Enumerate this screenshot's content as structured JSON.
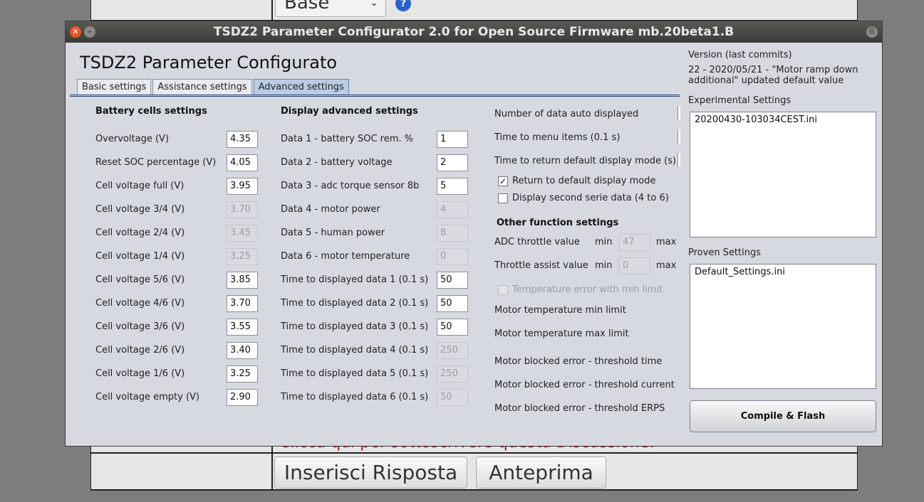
{
  "background": {
    "select_value": "Base",
    "help_icon": "help-icon",
    "subscribe_text": "Clicca qui per sottoscrivere questa Discussione.",
    "reply_button": "Inserisci Risposta",
    "preview_button": "Anteprima"
  },
  "window": {
    "title": "TSDZ2 Parameter Configurator 2.0 for Open Source Firmware mb.20beta1.B",
    "app_title": "TSDZ2 Parameter Configurato",
    "tabs": [
      "Basic settings",
      "Assistance settings",
      "Advanced settings"
    ],
    "active_tab": "Advanced settings"
  },
  "battery": {
    "title": "Battery cells settings",
    "rows": [
      {
        "label": "Overvoltage (V)",
        "value": "4.35",
        "enabled": true
      },
      {
        "label": "Reset SOC percentage (V)",
        "value": "4.05",
        "enabled": true
      },
      {
        "label": "Cell voltage full (V)",
        "value": "3.95",
        "enabled": true
      },
      {
        "label": "Cell voltage 3/4 (V)",
        "value": "3.70",
        "enabled": false
      },
      {
        "label": "Cell voltage 2/4 (V)",
        "value": "3.45",
        "enabled": false
      },
      {
        "label": "Cell voltage 1/4 (V)",
        "value": "3.25",
        "enabled": false
      },
      {
        "label": "Cell voltage 5/6 (V)",
        "value": "3.85",
        "enabled": true
      },
      {
        "label": "Cell voltage 4/6 (V)",
        "value": "3.70",
        "enabled": true
      },
      {
        "label": "Cell voltage 3/6 (V)",
        "value": "3.55",
        "enabled": true
      },
      {
        "label": "Cell voltage 2/6 (V)",
        "value": "3.40",
        "enabled": true
      },
      {
        "label": "Cell voltage 1/6 (V)",
        "value": "3.25",
        "enabled": true
      },
      {
        "label": "Cell voltage empty (V)",
        "value": "2.90",
        "enabled": true
      }
    ]
  },
  "display": {
    "title": "Display advanced settings",
    "rows": [
      {
        "label": "Data 1 - battery SOC rem. %",
        "value": "1",
        "enabled": true
      },
      {
        "label": "Data 2 - battery voltage",
        "value": "2",
        "enabled": true
      },
      {
        "label": "Data 3 - adc torque sensor 8b",
        "value": "5",
        "enabled": true
      },
      {
        "label": "Data 4 - motor power",
        "value": "4",
        "enabled": false
      },
      {
        "label": "Data 5 - human power",
        "value": "8",
        "enabled": false
      },
      {
        "label": "Data 6 - motor temperature",
        "value": "0",
        "enabled": false
      },
      {
        "label": "Time to displayed data 1 (0.1 s)",
        "value": "50",
        "enabled": true
      },
      {
        "label": "Time to displayed data 2 (0.1 s)",
        "value": "50",
        "enabled": true
      },
      {
        "label": "Time to displayed data 3 (0.1 s)",
        "value": "50",
        "enabled": true
      },
      {
        "label": "Time to displayed data 4 (0.1 s)",
        "value": "250",
        "enabled": false
      },
      {
        "label": "Time to displayed data 5 (0.1 s)",
        "value": "250",
        "enabled": false
      },
      {
        "label": "Time to displayed data 6 (0.1 s)",
        "value": "50",
        "enabled": false
      }
    ]
  },
  "display_extra": {
    "num_data_label": "Number of data auto displayed",
    "menu_time_label": "Time to menu items (0.1 s)",
    "return_time_label": "Time to return default display mode (s)",
    "return_default_label": "Return to default display mode",
    "return_default_checked": true,
    "second_serie_label": "Display second serie data (4 to 6)",
    "second_serie_checked": false
  },
  "other": {
    "title": "Other function settings",
    "adc_throttle_label": "ADC throttle value",
    "adc_min_label": "min",
    "adc_min_value": "47",
    "adc_max_label": "max",
    "throttle_assist_label": "Throttle assist value",
    "assist_min_label": "min",
    "assist_min_value": "0",
    "assist_max_label": "max",
    "temp_error_label": "Temperature error with min limit",
    "motor_temp_min_label": "Motor temperature min limit",
    "motor_temp_max_label": "Motor temperature max limit",
    "blocked_time_label": "Motor blocked error - threshold time",
    "blocked_current_label": "Motor blocked error - threshold current",
    "blocked_erps_label": "Motor blocked error - threshold ERPS"
  },
  "sidebar": {
    "version_title": "Version (last commits)",
    "version_text": "22 - 2020/05/21 - \"Motor ramp down additional\" updated default value",
    "experimental_title": "Experimental Settings",
    "experimental_items": [
      "20200430-103034CEST.ini"
    ],
    "proven_title": "Proven Settings",
    "proven_items": [
      "Default_Settings.ini"
    ],
    "compile_button": "Compile & Flash"
  }
}
